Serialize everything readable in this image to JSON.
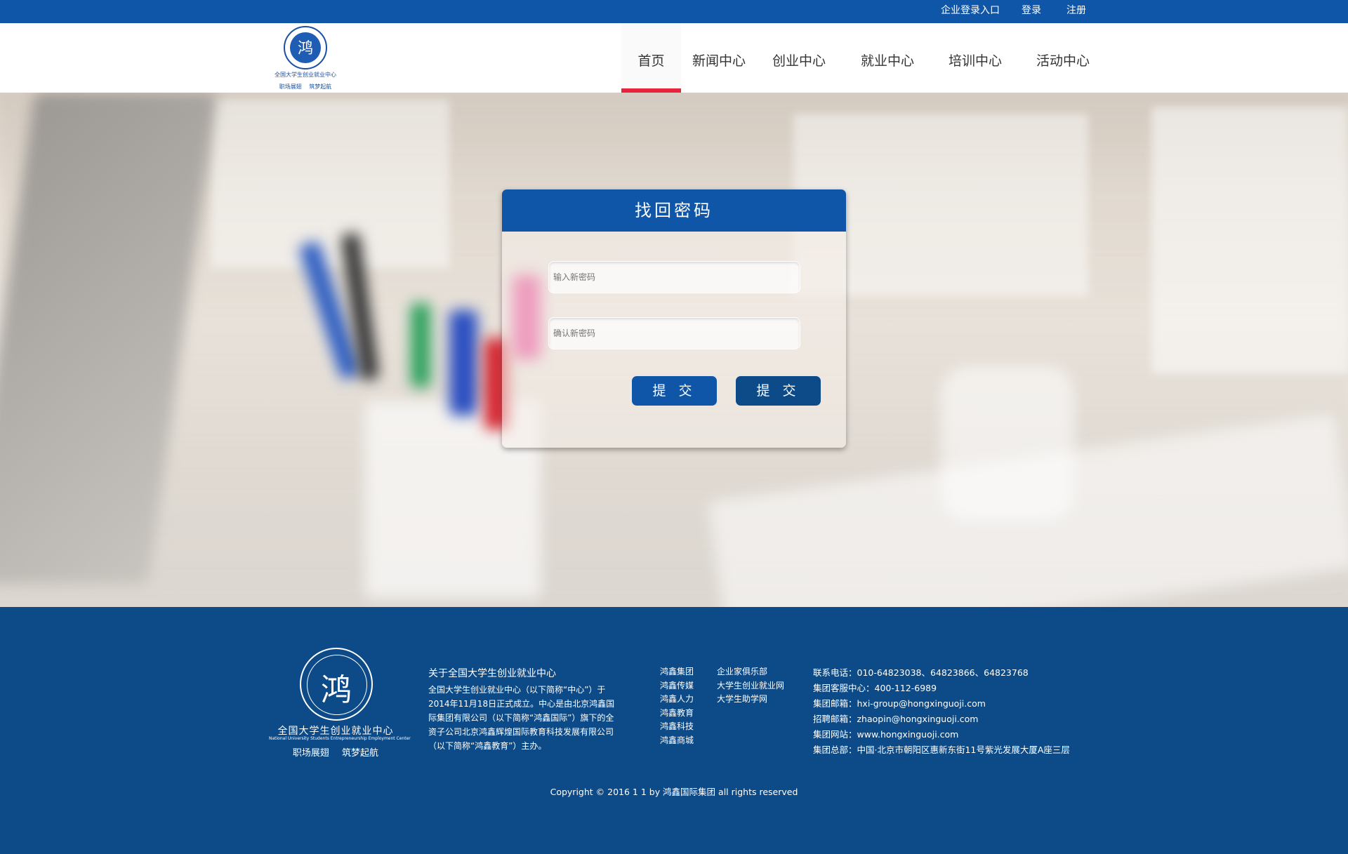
{
  "topbar": {
    "enterprise_login": "企业登录入口",
    "login": "登录",
    "register": "注册"
  },
  "logo": {
    "glyph": "鸿",
    "org_name": "全国大学生创业就业中心",
    "motto": "职场展翅 筑梦起航"
  },
  "nav": {
    "items": [
      {
        "label": "首页",
        "active": true
      },
      {
        "label": "新闻中心"
      },
      {
        "label": "创业中心"
      },
      {
        "label": "就业中心"
      },
      {
        "label": "培训中心"
      },
      {
        "label": "活动中心"
      }
    ]
  },
  "dialog": {
    "title": "找回密码",
    "new_password_placeholder": "输入新密码",
    "confirm_password_placeholder": "确认新密码",
    "submit_label_1": "提 交",
    "submit_label_2": "提 交"
  },
  "footer": {
    "logo": {
      "glyph": "鸿",
      "org_name": "全国大学生创业就业中心",
      "org_name_en": "National University Students Entrepreneurship Employment Center",
      "motto": "职场展翅 筑梦起航"
    },
    "about": {
      "title": "关于全国大学生创业就业中心",
      "text": "全国大学生创业就业中心（以下简称“中心”）于2014年11月18日正式成立。中心是由北京鸿鑫国际集团有限公司（以下简称“鸿鑫国际”）旗下的全资子公司北京鸿鑫辉煌国际教育科技发展有限公司（以下简称“鸿鑫教育”）主办。"
    },
    "links_col1": [
      "鸿鑫集团",
      "鸿鑫传媒",
      "鸿鑫人力",
      "鸿鑫教育",
      "鸿鑫科技",
      "鸿鑫商城"
    ],
    "links_col2": [
      "企业家俱乐部",
      "大学生创业就业网",
      "大学生助学网"
    ],
    "contact": [
      "联系电话：010-64823038、64823866、64823768",
      "集团客服中心：400-112-6989",
      "集团邮箱：hxi-group@hongxinguoji.com",
      "招聘邮箱：zhaopin@hongxinguoji.com",
      "集团网站：www.hongxinguoji.com",
      "集团总部：中国·北京市朝阳区惠新东街11号紫光发展大厦A座三层"
    ],
    "copyright": "Copyright © 2016 1 1 by 鸿鑫国际集团 all rights reserved"
  },
  "colors": {
    "brand_blue": "#0f55a8",
    "footer_blue": "#0c4a88",
    "nav_active": "#e8243c",
    "button_primary": "#0f55a8",
    "button_secondary": "#0c4a88"
  }
}
